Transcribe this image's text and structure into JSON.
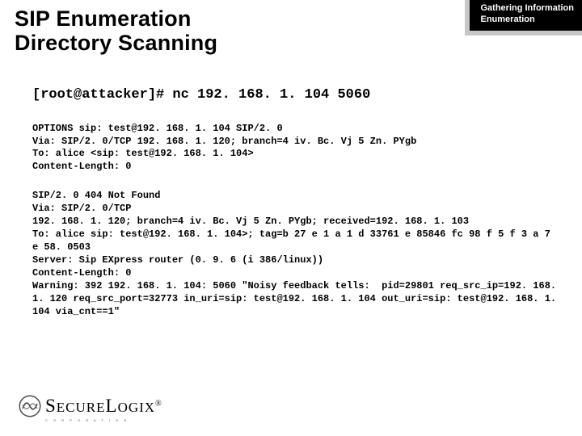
{
  "header": {
    "line1": "Gathering Information",
    "line2": "Enumeration"
  },
  "title": {
    "line1": "SIP Enumeration",
    "line2": "Directory Scanning"
  },
  "command": "[root@attacker]# nc 192. 168. 1. 104 5060",
  "request": "OPTIONS sip: test@192. 168. 1. 104 SIP/2. 0\nVia: SIP/2. 0/TCP 192. 168. 1. 120; branch=4 iv. Bc. Vj 5 Zn. PYgb\nTo: alice <sip: test@192. 168. 1. 104>\nContent-Length: 0",
  "response": "SIP/2. 0 404 Not Found\nVia: SIP/2. 0/TCP\n192. 168. 1. 120; branch=4 iv. Bc. Vj 5 Zn. PYgb; received=192. 168. 1. 103\nTo: alice sip: test@192. 168. 1. 104>; tag=b 27 e 1 a 1 d 33761 e 85846 fc 98 f 5 f 3 a 7 e 58. 0503\nServer: Sip EXpress router (0. 9. 6 (i 386/linux))\nContent-Length: 0\nWarning: 392 192. 168. 1. 104: 5060 \"Noisy feedback tells:  pid=29801 req_src_ip=192. 168. 1. 120 req_src_port=32773 in_uri=sip: test@192. 168. 1. 104 out_uri=sip: test@192. 168. 1. 104 via_cnt==1\"",
  "logo": {
    "text_main": "SECURELOGIX",
    "sub": "C O R P O R A T I O N"
  }
}
